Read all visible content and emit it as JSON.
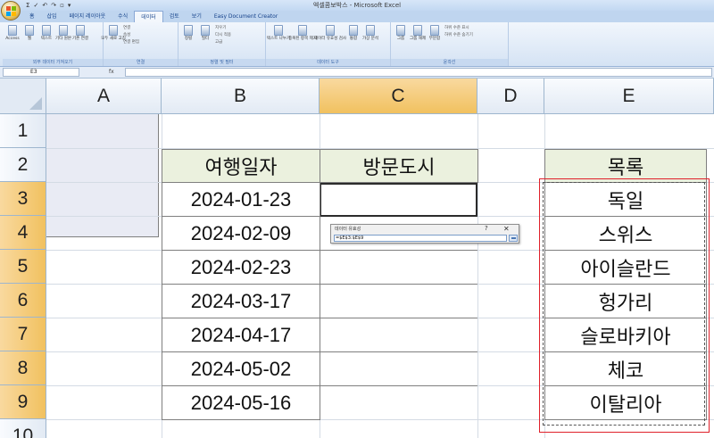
{
  "window": {
    "title": "엑셀콤보박스 - Microsoft Excel",
    "quick_access": [
      "Σ",
      "✓",
      "↶",
      "↷",
      "▫",
      "▾"
    ]
  },
  "ribbon_tabs": [
    "홈",
    "삽입",
    "페이지 레이아웃",
    "수식",
    "데이터",
    "검토",
    "보기",
    "Easy Document Creator"
  ],
  "active_tab": "데이터",
  "ribbon": {
    "groups": [
      {
        "label": "외부 데이터 가져오기",
        "buttons": [
          "Access",
          "웹",
          "텍스트",
          "기타 원본",
          "기존 연결"
        ]
      },
      {
        "label": "연결",
        "buttons": [
          "모두 새로 고침"
        ],
        "small": [
          "연결",
          "속성",
          "연결 편집"
        ]
      },
      {
        "label": "정렬 및 필터",
        "buttons": [
          "정렬",
          "필터"
        ],
        "small": [
          "지우기",
          "다시 적용",
          "고급"
        ]
      },
      {
        "label": "데이터 도구",
        "buttons": [
          "텍스트 나누기",
          "중복된 항목 제거",
          "데이터 유효성 검사",
          "통합",
          "가상 분석"
        ]
      },
      {
        "label": "윤곽선",
        "buttons": [
          "그룹",
          "그룹 해제",
          "부분합"
        ],
        "small": [
          "하위 수준 표시",
          "하위 수준 숨기기"
        ]
      }
    ]
  },
  "formula_bar": {
    "name_box": "E3",
    "fx_label": "fx",
    "formula": ""
  },
  "columns": [
    "A",
    "B",
    "C",
    "D",
    "E"
  ],
  "selected_column": "C",
  "rows": [
    "1",
    "2",
    "3",
    "4",
    "5",
    "6",
    "7",
    "8",
    "9",
    "10"
  ],
  "selected_rows": [
    "3",
    "4",
    "5",
    "6",
    "7",
    "8",
    "9"
  ],
  "sheet": {
    "header_date": "여행일자",
    "header_city": "방문도시",
    "header_list": "목록",
    "dates": [
      "2024-01-23",
      "2024-02-09",
      "2024-02-23",
      "2024-03-17",
      "2024-04-17",
      "2024-05-02",
      "2024-05-16"
    ],
    "countries": [
      "독일",
      "스위스",
      "아이슬란드",
      "헝가리",
      "슬로바키아",
      "체코",
      "이탈리아"
    ]
  },
  "dialog": {
    "title": "데이터 유효성",
    "help": "?",
    "close": "✕",
    "value": "=$E$3:$E$9"
  },
  "colors": {
    "header_fill": "#ebf1de",
    "c_range_fill": "#e9ebf4",
    "highlight_box": "#e0202a",
    "selected_header": "#f1c15f"
  }
}
